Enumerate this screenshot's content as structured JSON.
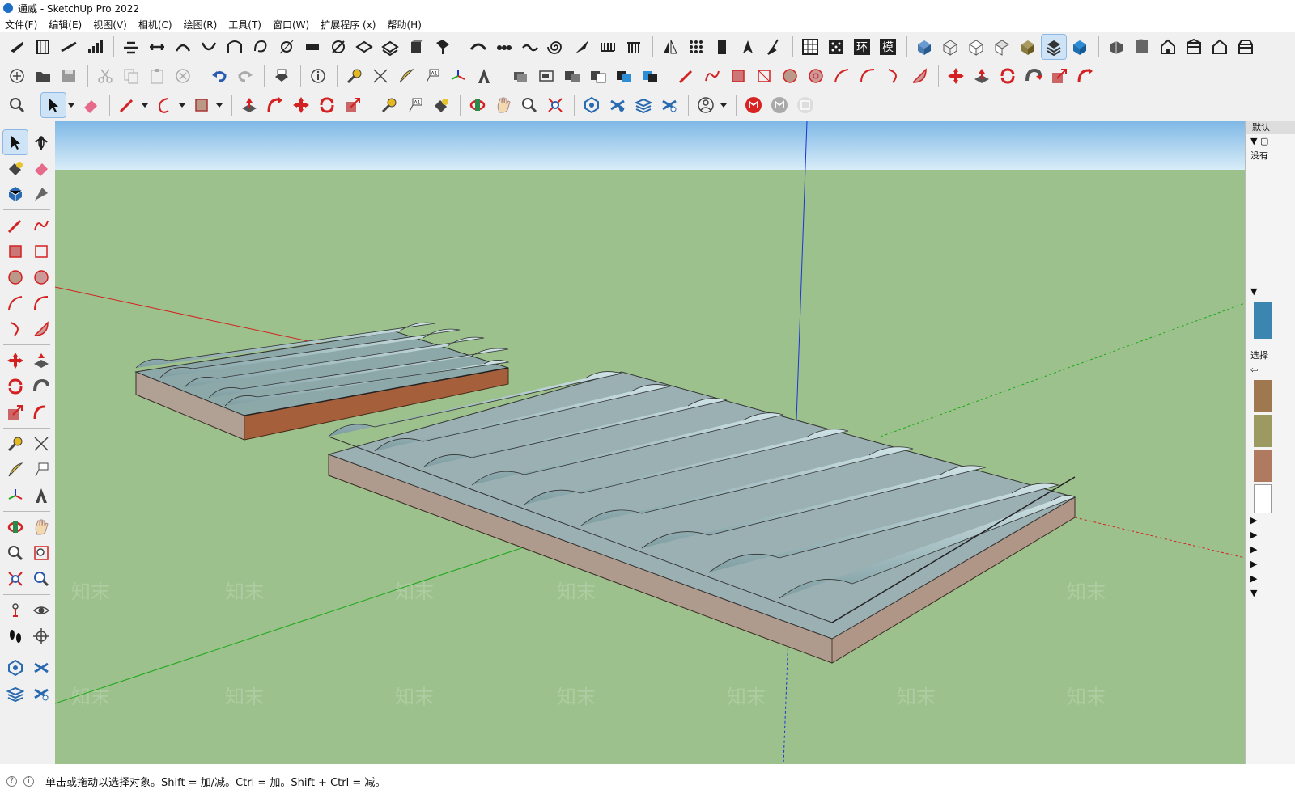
{
  "window": {
    "title": "通威 - SketchUp Pro 2022"
  },
  "menu": [
    "文件(F)",
    "编辑(E)",
    "视图(V)",
    "相机(C)",
    "绘图(R)",
    "工具(T)",
    "窗口(W)",
    "扩展程序 (x)",
    "帮助(H)"
  ],
  "status": {
    "hint": "单击或拖动以选择对象。Shift = 加/减。Ctrl = 加。Shift + Ctrl = 减。"
  },
  "right_panel": {
    "header": "默认",
    "row1": "没有",
    "row2": "选择"
  },
  "large_toolbar_labels": [
    "环",
    "模"
  ],
  "watermark": "知末",
  "colors": {
    "ground": "#9cc18c",
    "sky_top": "#7fb8e6",
    "sky_bottom": "#d8ecf8",
    "brick": "#a65f3b",
    "axis_red": "#d42020",
    "axis_green": "#1aa81a",
    "axis_blue": "#1a35d4",
    "selected_tool": "#cfe3f7",
    "record_red": "#d92222"
  }
}
